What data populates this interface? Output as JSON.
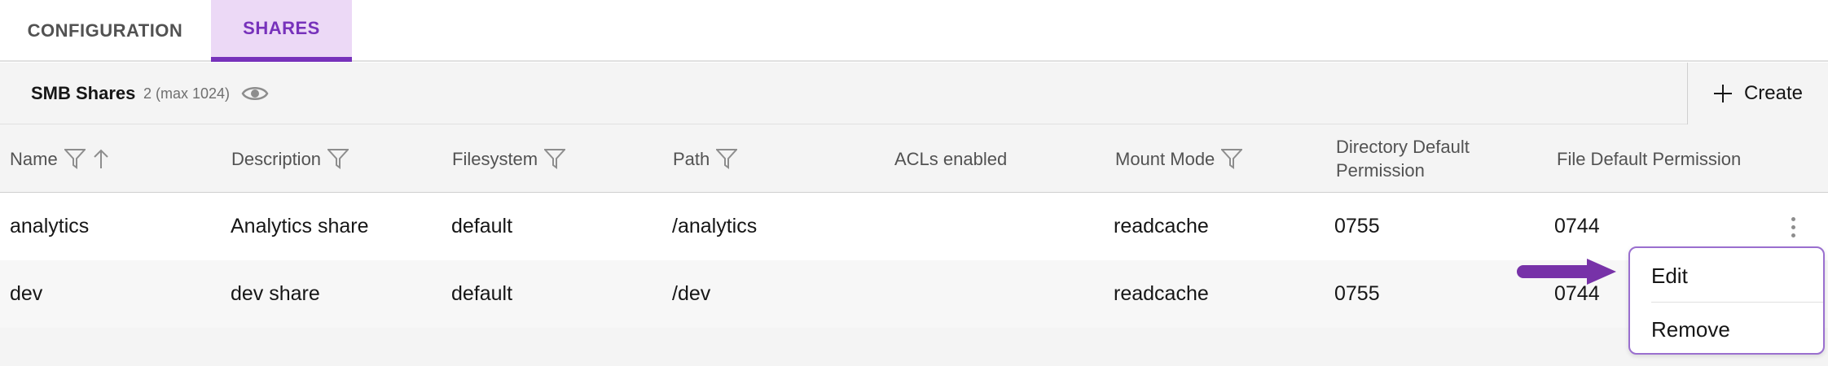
{
  "tabs": [
    {
      "label": "CONFIGURATION",
      "active": false
    },
    {
      "label": "SHARES",
      "active": true
    }
  ],
  "toolbar": {
    "title": "SMB Shares",
    "count": "2 (max 1024)",
    "create_label": "Create"
  },
  "columns": [
    {
      "label": "Name",
      "filter": true,
      "sort": "ascending"
    },
    {
      "label": "Description",
      "filter": true
    },
    {
      "label": "Filesystem",
      "filter": true
    },
    {
      "label": "Path",
      "filter": true
    },
    {
      "label": "ACLs enabled",
      "filter": false
    },
    {
      "label": "Mount Mode",
      "filter": true
    },
    {
      "label": "Directory Default Permission",
      "filter": false
    },
    {
      "label": "File Default Permission",
      "filter": false
    }
  ],
  "rows": [
    {
      "name": "analytics",
      "description": "Analytics share",
      "filesystem": "default",
      "path": "/analytics",
      "acls": "",
      "mount_mode": "readcache",
      "dir_perm": "0755",
      "file_perm": "0744"
    },
    {
      "name": "dev",
      "description": "dev share",
      "filesystem": "default",
      "path": "/dev",
      "acls": "",
      "mount_mode": "readcache",
      "dir_perm": "0755",
      "file_perm": "0744"
    }
  ],
  "row_menu": {
    "items": [
      "Edit",
      "Remove"
    ]
  },
  "colors": {
    "accent": "#7732bb",
    "accent_light": "#ecd9f6",
    "arrow": "#7732a8"
  },
  "icons": {
    "visibility": "eye-icon",
    "create": "plus-icon",
    "filter": "funnel-filter-icon",
    "sort": "arrow-up-icon",
    "row_actions": "overflow-menu-vertical-icon",
    "annotation": "arrow-right-icon"
  }
}
